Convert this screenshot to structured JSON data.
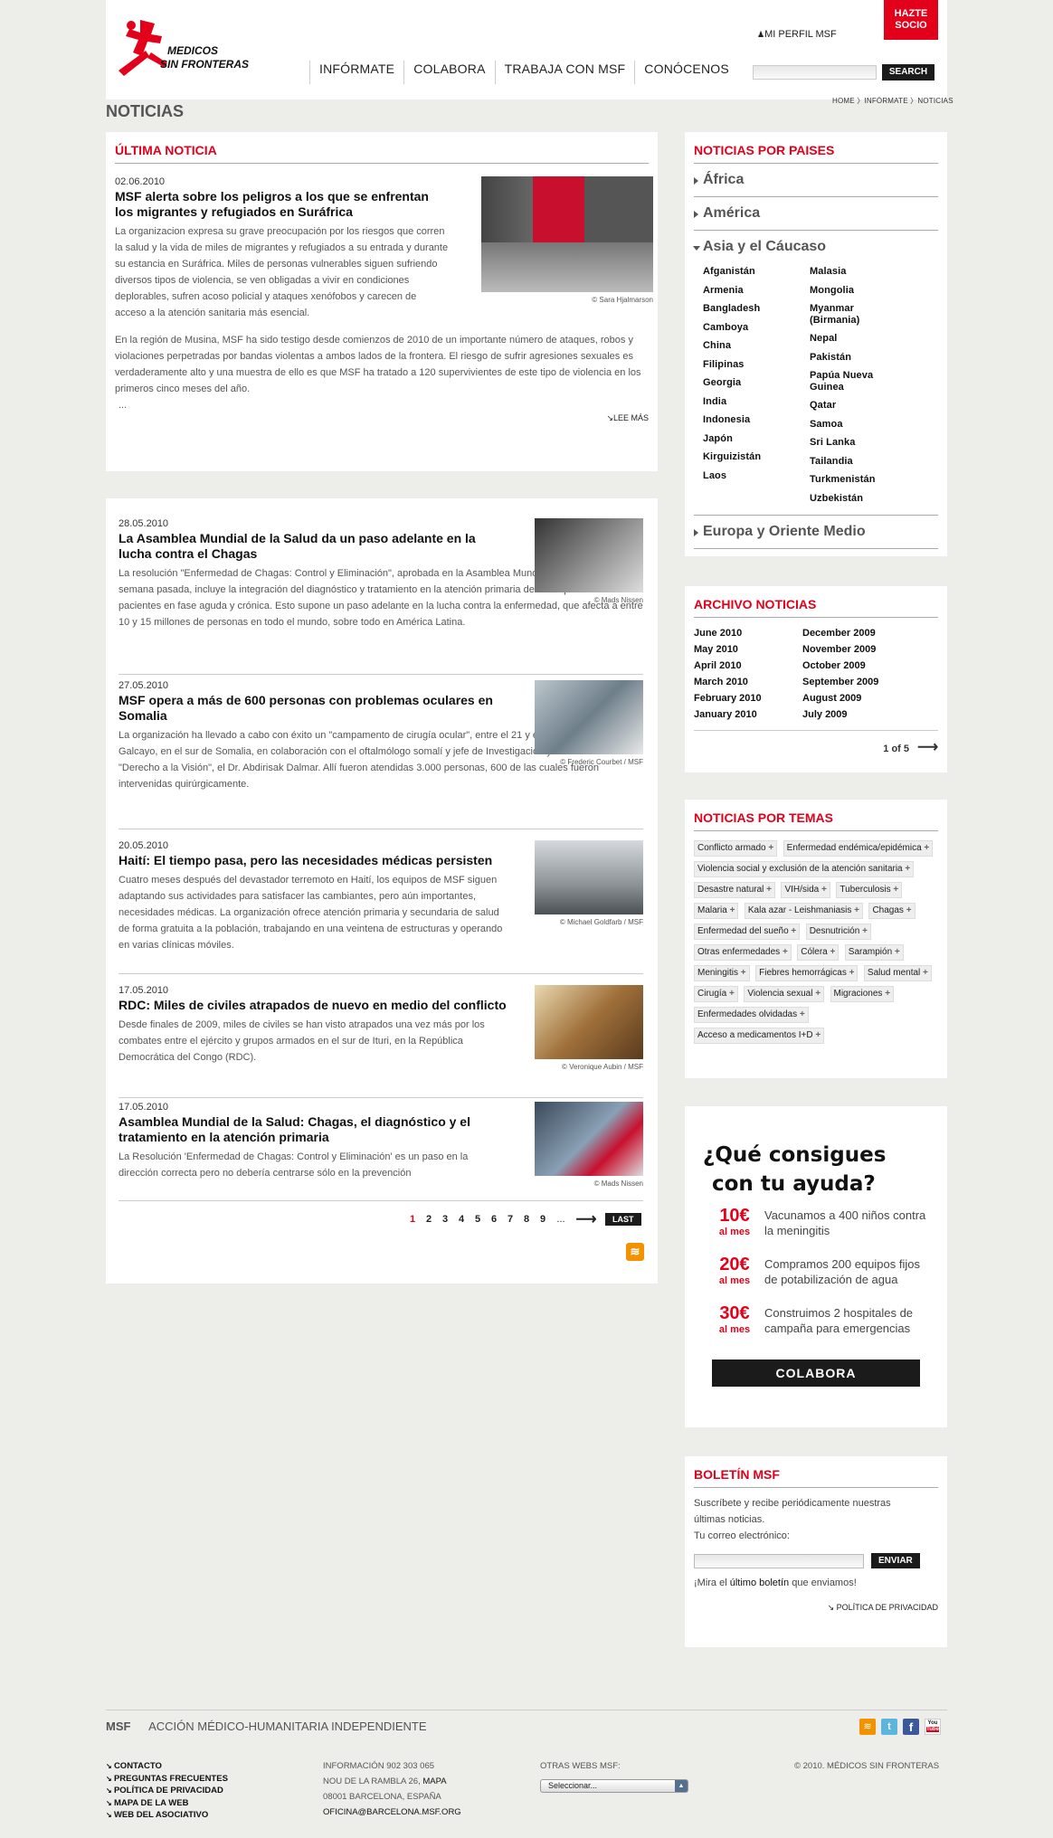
{
  "header": {
    "logo_text": "MEDICOS SIN FRONTERAS",
    "hazte_socio": "HAZTE SOCIO",
    "mi_perfil": "MI PERFIL MSF",
    "nav": [
      "INFÓRMATE",
      "COLABORA",
      "TRABAJA CON MSF",
      "CONÓCENOS"
    ],
    "search_button": "SEARCH"
  },
  "page": {
    "title": "NOTICIAS",
    "breadcrumb": "HOME 〉INFÓRMATE 〉NOTICIAS"
  },
  "ultima": {
    "heading": "ÚLTIMA NOTICIA",
    "date": "02.06.2010",
    "title": "MSF alerta sobre los peligros a los que se enfrentan los migrantes y refugiados en Suráfrica",
    "p1": "La organizacion expresa su grave preocupación por los riesgos que corren la salud y la vida de miles de migrantes y refugiados a su entrada y durante su estancia en Suráfrica. Miles de personas vulnerables siguen sufriendo diversos tipos de violencia, se ven obligadas a vivir en condiciones deplorables, sufren acoso policial y ataques xenófobos y carecen de acceso a la atención sanitaria más esencial.",
    "p2": "En la región de Musina, MSF ha sido testigo desde comienzos de 2010 de un importante número de ataques, robos y violaciones perpetradas por bandas violentas a ambos lados de la frontera. El riesgo de sufrir agresiones sexuales es verdaderamente alto y una muestra de ello es que MSF ha tratado a 120 supervivientes de este tipo de violencia en los primeros cinco meses del año.",
    "ellipsis": "...",
    "credit": "© Sara Hjalmarson",
    "lee_mas": "LEE MÁS"
  },
  "news": [
    {
      "date": "28.05.2010",
      "title": "La Asamblea Mundial de la Salud da un paso adelante en la lucha contra el Chagas",
      "body": "La resolución \"Enfermedad de Chagas: Control y Eliminación\", aprobada en la Asamblea Mundial de la Salud la semana pasada, incluye la integración del diagnóstico y tratamiento en la atención primaria de salud para los pacientes en fase aguda y crónica. Esto supone un paso adelante en la lucha contra la enfermedad, que afecta a entre 10 y 15 millones de personas en todo el mundo, sobre todo en América Latina.",
      "credit": "© Mads Nissen"
    },
    {
      "date": "27.05.2010",
      "title": "MSF opera a más de 600 personas con problemas oculares en Somalia",
      "body": "La organización ha llevado a cabo con éxito un \"campamento de cirugía ocular\", entre el 21 y el 29 de abril de 2010 en Galcayo, en el sur de Somalia, en colaboración con el oftalmólogo somalí y jefe de Investigación y Formación de \"Derecho a la Visión\", el Dr. Abdirisak Dalmar. Allí fueron atendidas 3.000 personas, 600 de las cuales fueron intervenidas quirúrgicamente.",
      "credit": "© Frederic Courbet / MSF"
    },
    {
      "date": "20.05.2010",
      "title": "Haití: El tiempo pasa, pero las necesidades médicas persisten",
      "body": "Cuatro meses después del devastador terremoto en Haití, los equipos de MSF siguen adaptando sus actividades para satisfacer las cambiantes, pero aún importantes, necesidades médicas. La organización ofrece atención primaria y secundaria de salud de forma gratuita a la población, trabajando en una veintena de estructuras y operando en varias clínicas móviles.",
      "credit": "© Michael Goldfarb / MSF"
    },
    {
      "date": "17.05.2010",
      "title": "RDC: Miles de civiles atrapados de nuevo en medio del conflicto",
      "body": "Desde finales de 2009, miles de civiles se han visto atrapados una vez más por los combates entre el ejército y grupos armados en el sur de Ituri, en la República Democrática del Congo (RDC).",
      "credit": "© Veronique Aubin / MSF"
    },
    {
      "date": "17.05.2010",
      "title": "Asamblea Mundial de la Salud: Chagas, el diagnóstico y el tratamiento en la atención primaria",
      "body": "La Resolución 'Enfermedad de Chagas: Control y Eliminación' es un paso en la dirección correcta pero no debería centrarse sólo en la prevención",
      "credit": "© Mads Nissen"
    }
  ],
  "pagination": {
    "current": "1",
    "pages": [
      "2",
      "3",
      "4",
      "5",
      "6",
      "7",
      "8",
      "9"
    ],
    "dots": "...",
    "last": "LAST"
  },
  "paises": {
    "heading": "NOTICIAS POR PAISES",
    "regions": [
      "África",
      "América",
      "Asia y el Cáucaso",
      "Europa y Oriente Medio"
    ],
    "col1": [
      "Afganistán",
      "Armenia",
      "Bangladesh",
      "Camboya",
      "China",
      "Filipinas",
      "Georgia",
      "India",
      "Indonesia",
      "Japón",
      "Kirguizistán",
      "Laos"
    ],
    "col2": [
      "Malasia",
      "Mongolia",
      "Myanmar (Birmania)",
      "Nepal",
      "Pakistán",
      "Papúa Nueva Guinea",
      "Qatar",
      "Samoa",
      "Sri Lanka",
      "Tailandia",
      "Turkmenistán",
      "Uzbekistán"
    ]
  },
  "archivo": {
    "heading": "ARCHIVO NOTICIAS",
    "col1": [
      "June 2010",
      "May 2010",
      "April 2010",
      "March 2010",
      "February 2010",
      "January 2010"
    ],
    "col2": [
      "December 2009",
      "November 2009",
      "October 2009",
      "September 2009",
      "August 2009",
      "July 2009"
    ],
    "pager": "1 of 5"
  },
  "temas": {
    "heading": "NOTICIAS POR TEMAS",
    "tags": [
      "Conflicto armado",
      "Enfermedad endémica/epidémica",
      "Violencia social y exclusión de la atención sanitaria",
      "Desastre natural",
      "VIH/sida",
      "Tuberculosis",
      "Malaria",
      "Kala azar - Leishmaniasis",
      "Chagas",
      "Enfermedad del sueño",
      "Desnutrición",
      "Otras enfermedades",
      "Cólera",
      "Sarampión",
      "Meningitis",
      "Fiebres hemorrágicas",
      "Salud mental",
      "Cirugía",
      "Violencia sexual",
      "Migraciones",
      "Enfermedades olvidadas",
      "Acceso a medicamentos I+D"
    ]
  },
  "ayuda": {
    "heading_1": "¿Qué consigues",
    "heading_2": "con tu ayuda?",
    "per_month": "al mes",
    "items": [
      {
        "amount": "10€",
        "text": "Vacunamos a 400 niños contra la meningitis"
      },
      {
        "amount": "20€",
        "text": "Compramos 200 equipos fijos de potabilización de agua"
      },
      {
        "amount": "30€",
        "text": "Construimos 2 hospitales de campaña para emergencias"
      }
    ],
    "button": "COLABORA"
  },
  "boletin": {
    "heading": "BOLETÍN MSF",
    "intro": "Suscríbete y recibe periódicamente nuestras últimas noticias.",
    "email_label": "Tu correo electrónico:",
    "button": "ENVIAR",
    "mira_prefix": "¡Mira el ",
    "mira_link": "último boletín",
    "mira_suffix": " que enviamos!",
    "privacy": "POLÍTICA DE PRIVACIDAD"
  },
  "footer": {
    "msf": "MSF",
    "tagline": "ACCIÓN MÉDICO-HUMANITARIA INDEPENDIENTE",
    "links": [
      "CONTACTO",
      "PREGUNTAS FRECUENTES",
      "POLÍTICA DE PRIVACIDAD",
      "MAPA DE LA WEB",
      "WEB DEL ASOCIATIVO"
    ],
    "info_phone": "INFORMACIÓN 902 303 065",
    "address_1": "NOU DE LA RAMBLA 26,",
    "address_map": "MAPA",
    "address_2": "08001 BARCELONA, ESPAÑA",
    "email": "OFICINA@BARCELONA.MSF.ORG",
    "otras_label": "OTRAS WEBS MSF:",
    "select_value": "Seleccionar...",
    "copyright": "© 2010. MÉDICOS SIN FRONTERAS",
    "social_you": "You",
    "social_tube": "Tube"
  },
  "colors": {
    "accent": "#e2001a",
    "background": "#ededea",
    "dark": "#1b1b1b"
  }
}
